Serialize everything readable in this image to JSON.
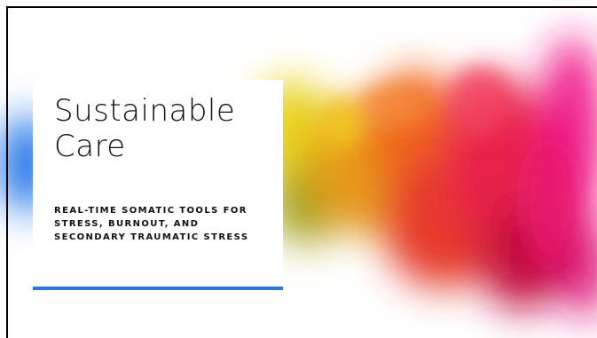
{
  "slide": {
    "title": "Sustainable Care",
    "subtitle": "REAL-TIME SOMATIC TOOLS FOR STRESS, BURNOUT, AND SECONDARY TRAUMATIC STRESS"
  },
  "colors": {
    "accent": "#2f76d9",
    "text": "#111111",
    "background": "#ffffff"
  }
}
